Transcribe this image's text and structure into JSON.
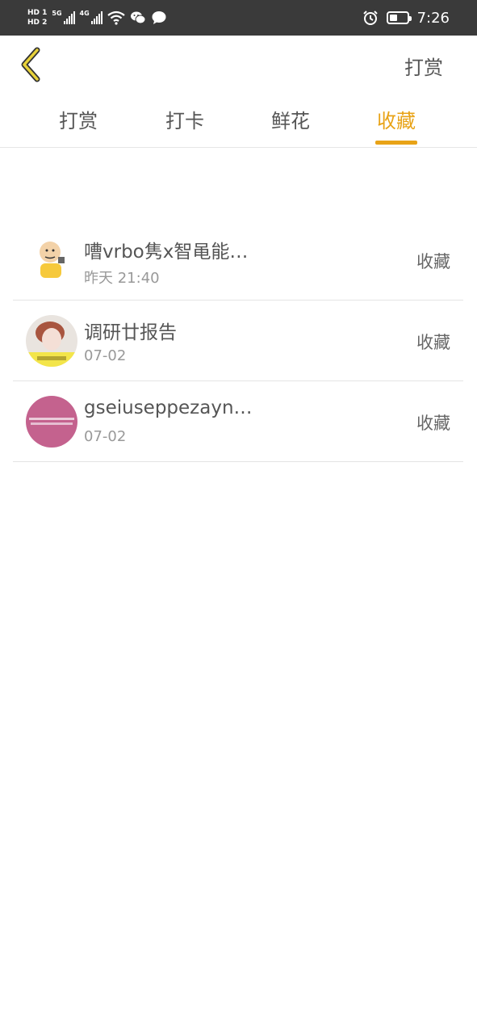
{
  "status_bar": {
    "sim1_label": "HD 1",
    "sim2_label": "HD 2",
    "network1": "5G",
    "network2": "4G",
    "time": "7:26",
    "battery_percent": 45
  },
  "header": {
    "back_icon": "chevron-left-icon",
    "action_label": "打赏"
  },
  "tabs": [
    {
      "label": "打赏",
      "active": false
    },
    {
      "label": "打卡",
      "active": false
    },
    {
      "label": "鲜花",
      "active": false
    },
    {
      "label": "收藏",
      "active": true
    }
  ],
  "items": [
    {
      "title": "嘈vrbo隽x智黾能…",
      "date": "昨天 21:40",
      "type": "收藏",
      "avatar": "cartoon-avatar"
    },
    {
      "title": "调研廿报告",
      "date": "07-02",
      "type": "收藏",
      "avatar": "photo-avatar"
    },
    {
      "title": "gseiuseppezayn…",
      "date": "07-02",
      "type": "收藏",
      "avatar": "pink-avatar"
    }
  ],
  "colors": {
    "accent": "#e8a317",
    "status_bar_bg": "#3a3a3a",
    "back_icon_stroke": "#e8d23a"
  }
}
